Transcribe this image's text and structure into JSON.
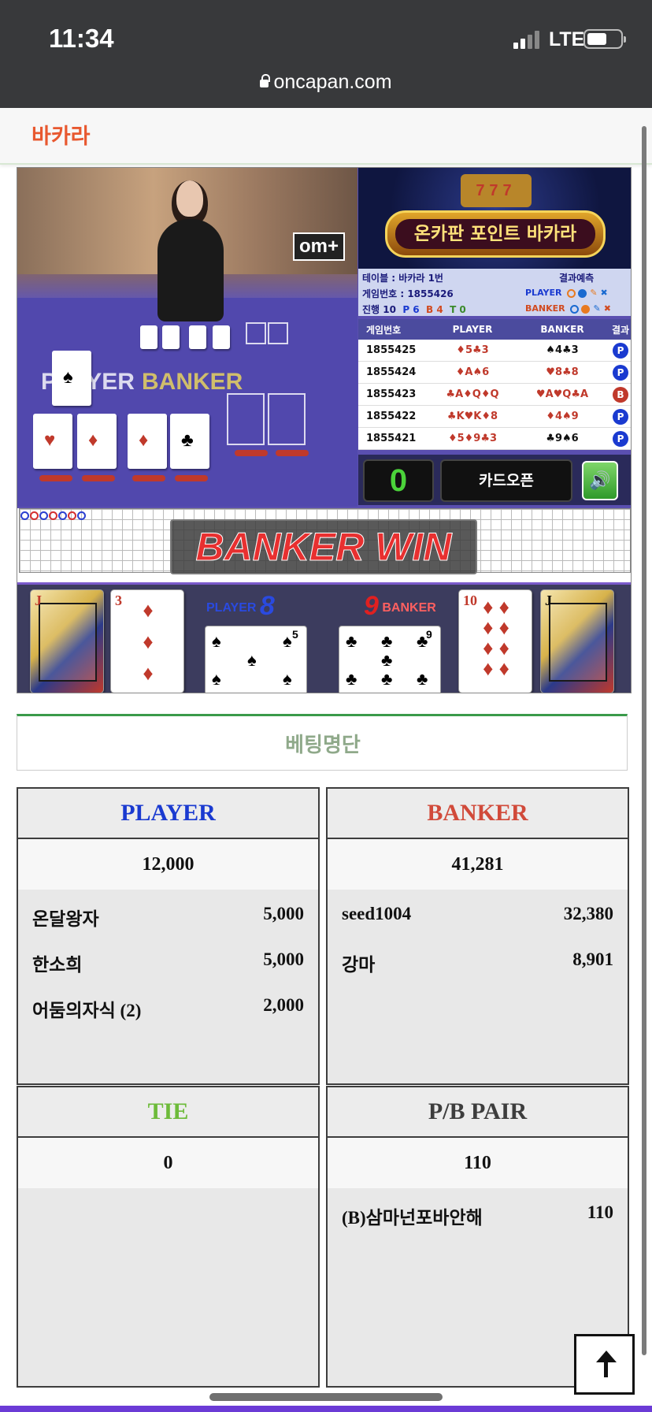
{
  "status_bar": {
    "time": "11:34",
    "network": "LTE"
  },
  "browser": {
    "url": "oncapan.com"
  },
  "page": {
    "title": "바카라"
  },
  "game": {
    "promo_title": "온카판 포인트 바카라",
    "promo_slot": "777",
    "video_logo": "om+",
    "video_player_label": "PLAYER",
    "video_banker_label": "BANKER",
    "table_info": {
      "table": "테이블 : 바카라 1번",
      "game_no": "게임번호 : 1855426",
      "progress": "진행 10",
      "p": "P 6",
      "b": "B 4",
      "t": "T 0",
      "prediction_title": "결과예측",
      "player_pred": "PLAYER",
      "banker_pred": "BANKER"
    },
    "history_headers": [
      "게임번호",
      "PLAYER",
      "BANKER",
      "결과"
    ],
    "history": [
      {
        "no": "1855425",
        "player": "♦5♣3",
        "banker": "♠4♣3",
        "result": "P"
      },
      {
        "no": "1855424",
        "player": "♦A♠6",
        "banker": "♥8♣8",
        "result": "P"
      },
      {
        "no": "1855423",
        "player": "♣A♦Q♦Q",
        "banker": "♥A♥Q♣A",
        "result": "B"
      },
      {
        "no": "1855422",
        "player": "♣K♥K♦8",
        "banker": "♦4♠9",
        "result": "P"
      },
      {
        "no": "1855421",
        "player": "♦5♦9♣3",
        "banker": "♣9♠6",
        "result": "P"
      }
    ],
    "counter": "0",
    "card_open": "카드오픈",
    "sound_icon": "speaker-icon",
    "result_banner": "BANKER WIN",
    "player_score_label": "PLAYER",
    "player_score": "8",
    "banker_score_label": "BANKER",
    "banker_score": "9",
    "player_cards": [
      "J",
      "3",
      "5"
    ],
    "banker_cards": [
      "9",
      "10",
      "J"
    ]
  },
  "betting": {
    "title": "베팅명단",
    "player": {
      "label": "PLAYER",
      "total": "12,000",
      "entries": [
        {
          "name": "온달왕자",
          "amount": "5,000"
        },
        {
          "name": "한소희",
          "amount": "5,000"
        },
        {
          "name": "어둠의자식 (2)",
          "amount": "2,000"
        }
      ]
    },
    "banker": {
      "label": "BANKER",
      "total": "41,281",
      "entries": [
        {
          "name": "seed1004",
          "amount": "32,380"
        },
        {
          "name": "강마",
          "amount": "8,901"
        }
      ]
    },
    "tie": {
      "label": "TIE",
      "total": "0",
      "entries": []
    },
    "pair": {
      "label": "P/B PAIR",
      "total": "110",
      "entries": [
        {
          "name": "(B)삼마넌포바안해",
          "amount": "110"
        }
      ]
    }
  },
  "colors": {
    "title_orange": "#e8582f",
    "player_blue": "#1a3ad0",
    "banker_red": "#d14a3a",
    "tie_green": "#6dbb3a",
    "pair_dark": "#3d3d3d",
    "counter_green": "#4bd33a"
  },
  "icons": {
    "scroll_top": "arrow-up-icon",
    "lock": "lock-icon"
  }
}
